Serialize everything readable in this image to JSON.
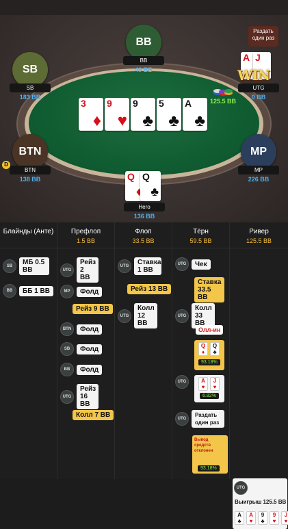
{
  "table": {
    "split_button": "Раздать один раз",
    "win_text": "WIN",
    "pot": "125.5 BB",
    "board": [
      {
        "rank": "3",
        "suit": "♦",
        "color": "red"
      },
      {
        "rank": "9",
        "suit": "♥",
        "color": "red"
      },
      {
        "rank": "9",
        "suit": "♣",
        "color": "blk"
      },
      {
        "rank": "5",
        "suit": "♣",
        "color": "blk"
      },
      {
        "rank": "A",
        "suit": "♣",
        "color": "blk"
      }
    ],
    "seats": {
      "bb": {
        "avatar": "BB",
        "name": "BB",
        "stack": "49 BB",
        "color": "#2f5d33"
      },
      "sb": {
        "avatar": "SB",
        "name": "SB",
        "stack": "183 BB",
        "color": "#5d6b34"
      },
      "btn": {
        "avatar": "BTN",
        "name": "BTN",
        "stack": "138 BB",
        "color": "#4a3426"
      },
      "mp": {
        "avatar": "MP",
        "name": "MP",
        "stack": "226 BB",
        "color": "#2b3f5c"
      },
      "utg": {
        "name": "UTG",
        "stack": "0 BB"
      },
      "hero": {
        "name": "Hero",
        "stack": "136 BB",
        "cards": [
          {
            "rank": "Q",
            "suit": "♦",
            "color": "red"
          },
          {
            "rank": "Q",
            "suit": "♣",
            "color": "blk"
          }
        ]
      }
    },
    "utg_cards": [
      {
        "rank": "A",
        "suit": "♥",
        "color": "red"
      },
      {
        "rank": "J",
        "suit": "♥",
        "color": "red"
      }
    ]
  },
  "history": {
    "columns": [
      {
        "title": "Блайнды (Анте)",
        "pot": ""
      },
      {
        "title": "Префлоп",
        "pot": "1.5 BB"
      },
      {
        "title": "Флоп",
        "pot": "33.5 BB"
      },
      {
        "title": "Тёрн",
        "pot": "59.5 BB"
      },
      {
        "title": "Ривер",
        "pot": "125.5 BB"
      }
    ],
    "blinds": [
      {
        "pos": "SB",
        "text": "МБ 0.5 BB"
      },
      {
        "pos": "BB",
        "text": "ББ 1 BB"
      }
    ],
    "preflop": [
      {
        "pos": "UTG",
        "text": "Рейз 2 BB"
      },
      {
        "pos": "MP",
        "text": "Фолд"
      },
      {
        "hero": "Рейз 9 BB"
      },
      {
        "pos": "BTN",
        "text": "Фолд"
      },
      {
        "pos": "SB",
        "text": "Фолд"
      },
      {
        "pos": "BB",
        "text": "Фолд"
      },
      {
        "pos": "UTG",
        "text": "Рейз 16 BB"
      },
      {
        "hero": "Колл 7 BB"
      }
    ],
    "flop": [
      {
        "pos": "UTG",
        "text": "Ставка 1 BB"
      },
      {
        "hero": "Рейз 13 BB"
      },
      {
        "pos": "UTG",
        "text": "Колл 12 BB"
      }
    ],
    "turn": [
      {
        "pos": "UTG",
        "text": "Чек"
      },
      {
        "hero": "Ставка 33.5 BB"
      },
      {
        "pos": "UTG",
        "text": "Колл 33 BB"
      },
      {
        "allin": "Олл-ин"
      },
      {
        "hero_equity": "93.18%"
      },
      {
        "pos": "UTG",
        "equity": "6.82%"
      },
      {
        "pos": "UTG",
        "text": "Раздать один раз"
      },
      {
        "hero_msg": "Вывод средств отклонен",
        "equity": "93.18%"
      }
    ],
    "river": {
      "pos": "UTG",
      "text": "Выигрыш 125.5 BB",
      "cards": [
        {
          "rank": "A",
          "suit": "♣",
          "color": "blk"
        },
        {
          "rank": "A",
          "suit": "♥",
          "color": "red"
        },
        {
          "rank": "9",
          "suit": "♣",
          "color": "blk"
        },
        {
          "rank": "9",
          "suit": "♥",
          "color": "red"
        },
        {
          "rank": "J",
          "suit": "♥",
          "color": "red"
        }
      ]
    }
  }
}
